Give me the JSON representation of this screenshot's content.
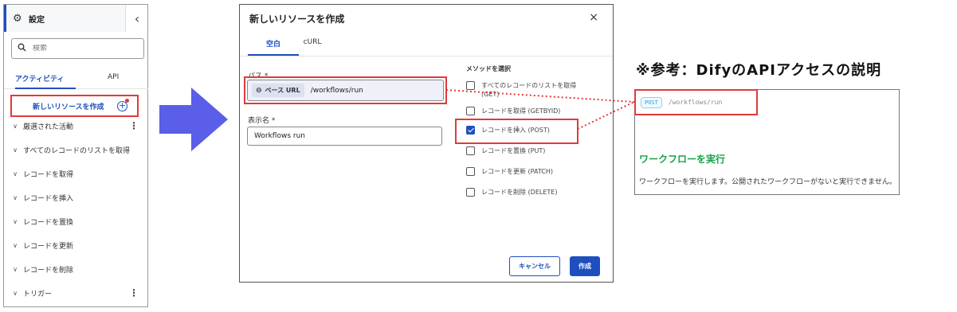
{
  "left_panel": {
    "title": "設定",
    "search_placeholder": "検索",
    "tabs": [
      "アクティビティ",
      "API"
    ],
    "new_resource_label": "新しいリソースを作成",
    "items": [
      {
        "label": "厳選された活動",
        "kebab": true
      },
      {
        "label": "すべてのレコードのリストを取得",
        "kebab": false
      },
      {
        "label": "レコードを取得",
        "kebab": false
      },
      {
        "label": "レコードを挿入",
        "kebab": false
      },
      {
        "label": "レコードを置換",
        "kebab": false
      },
      {
        "label": "レコードを更新",
        "kebab": false
      },
      {
        "label": "レコードを削除",
        "kebab": false
      },
      {
        "label": "トリガー",
        "kebab": true
      }
    ]
  },
  "dialog": {
    "title": "新しいリソースを作成",
    "close_glyph": "×",
    "tabs": [
      "空白",
      "cURL"
    ],
    "path_label": "パス *",
    "base_url_chip": "ベース URL",
    "path_value": "/workflows/run",
    "name_label": "表示名 *",
    "name_value": "Workflows run",
    "method_title": "メソッドを選択",
    "methods": [
      {
        "label": "すべてのレコードのリストを取得 (GET)",
        "checked": false
      },
      {
        "label": "レコードを取得 (GETBYID)",
        "checked": false
      },
      {
        "label": "レコードを挿入 (POST)",
        "checked": true
      },
      {
        "label": "レコードを置換 (PUT)",
        "checked": false
      },
      {
        "label": "レコードを更新 (PATCH)",
        "checked": false
      },
      {
        "label": "レコードを削除 (DELETE)",
        "checked": false
      }
    ],
    "cancel_label": "キャンセル",
    "create_label": "作成"
  },
  "reference": {
    "heading": "※参考：DifyのAPIアクセスの説明",
    "method_badge": "POST",
    "path": "/workflows/run",
    "title": "ワークフローを実行",
    "description": "ワークフローを実行します。公開されたワークフローがないと実行できません。"
  },
  "colors": {
    "accent": "#1f4fbf",
    "highlight": "#e03a3a",
    "arrow": "#5a5ee8",
    "reference_title": "#18a34a"
  }
}
